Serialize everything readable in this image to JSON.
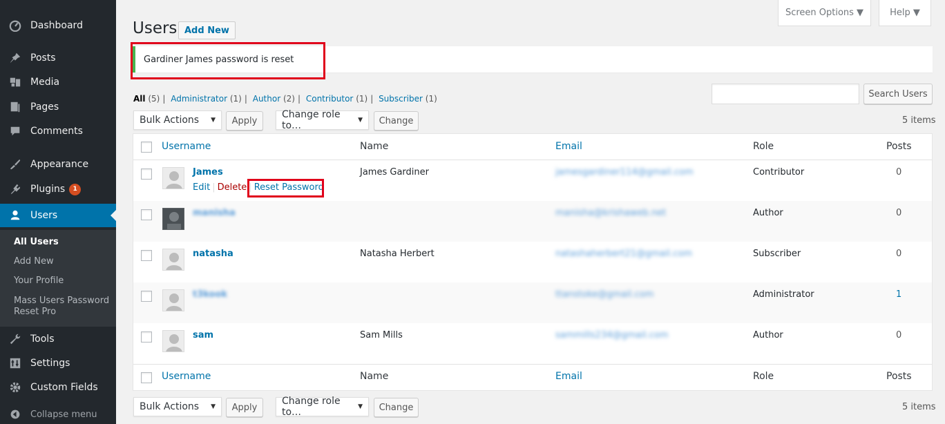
{
  "sidebar": {
    "menu": [
      {
        "label": "Dashboard",
        "icon": "dashboard-icon"
      },
      {
        "label": "Posts",
        "icon": "pin-icon"
      },
      {
        "label": "Media",
        "icon": "media-icon"
      },
      {
        "label": "Pages",
        "icon": "pages-icon"
      },
      {
        "label": "Comments",
        "icon": "comments-icon"
      },
      {
        "label": "Appearance",
        "icon": "appearance-icon"
      },
      {
        "label": "Plugins",
        "icon": "plugins-icon",
        "badge": "1"
      },
      {
        "label": "Users",
        "icon": "users-icon",
        "active": true
      },
      {
        "label": "Tools",
        "icon": "tools-icon"
      },
      {
        "label": "Settings",
        "icon": "settings-icon"
      },
      {
        "label": "Custom Fields",
        "icon": "gear-icon"
      },
      {
        "label": "Collapse menu",
        "icon": "collapse-icon"
      }
    ],
    "submenu": [
      "All Users",
      "Add New",
      "Your Profile",
      "Mass Users Password",
      "Reset Pro"
    ]
  },
  "top": {
    "screen_options": "Screen Options ▼",
    "help": "Help ▼"
  },
  "page": {
    "title": "Users",
    "add_new": "Add New"
  },
  "notice": "Gardiner James password is reset",
  "filters": {
    "all": "All",
    "all_count": "(5)",
    "administrator": "Administrator",
    "administrator_count": "(1)",
    "author": "Author",
    "author_count": "(2)",
    "contributor": "Contributor",
    "contributor_count": "(1)",
    "subscriber": "Subscriber",
    "subscriber_count": "(1)"
  },
  "search": {
    "button": "Search Users",
    "value": ""
  },
  "actions": {
    "bulk": "Bulk Actions",
    "apply": "Apply",
    "change_role": "Change role to…",
    "change": "Change",
    "items": "5 items"
  },
  "table": {
    "columns": {
      "username": "Username",
      "name": "Name",
      "email": "Email",
      "role": "Role",
      "posts": "Posts"
    },
    "rows": [
      {
        "username": "James",
        "name": "James Gardiner",
        "email": "jamesgardiner114@gmail.com",
        "role": "Contributor",
        "posts": "0"
      },
      {
        "username": "manisha",
        "name": "",
        "email": "manisha@krishaweb.net",
        "role": "Author",
        "posts": "0"
      },
      {
        "username": "natasha",
        "name": "Natasha Herbert",
        "email": "natashaherbert21@gmail.com",
        "role": "Subscriber",
        "posts": "0"
      },
      {
        "username": "t3kook",
        "name": "",
        "email": "ttanstoke@gmail.com",
        "role": "Administrator",
        "posts": "1"
      },
      {
        "username": "sam",
        "name": "Sam Mills",
        "email": "sammills234@gmail.com",
        "role": "Author",
        "posts": "0"
      }
    ],
    "row_actions": {
      "edit": "Edit",
      "delete": "Delete",
      "reset": "Reset Password"
    }
  }
}
